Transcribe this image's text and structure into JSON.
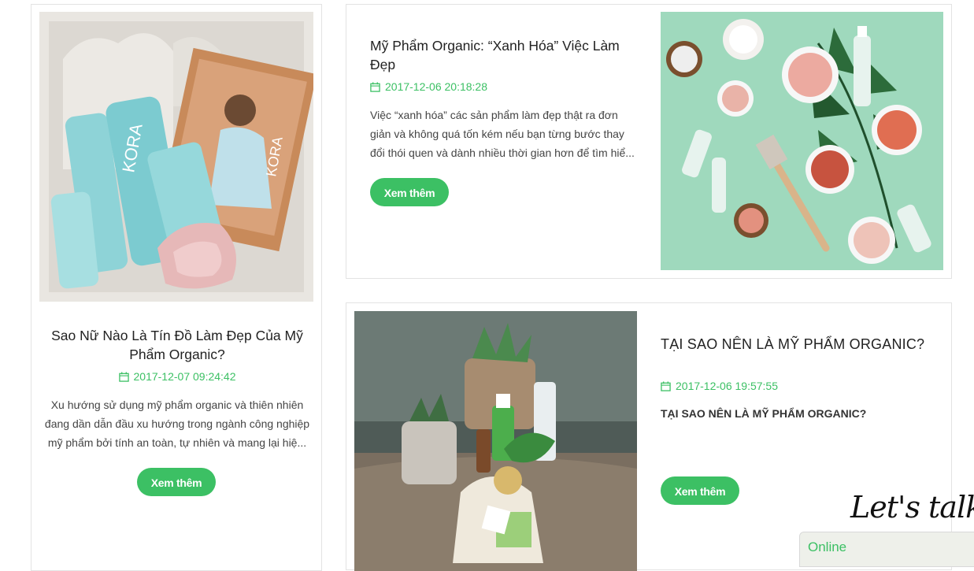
{
  "posts": [
    {
      "title_line1": "Sao Nữ Nào Là Tín Đồ Làm Đẹp Của Mỹ",
      "title_line2": "Phẩm Organic?",
      "date": "2017-12-07 09:24:42",
      "excerpt_line1": "Xu hướng sử dụng mỹ phẩm organic và thiên nhiên",
      "excerpt_line2": "đang dần dẫn đầu xu hướng trong ngành công nghiệp",
      "excerpt_line3": "mỹ phẩm bởi tính an toàn, tự nhiên và mang lại hiệ...",
      "button": "Xem thêm",
      "image_label": "KORA"
    },
    {
      "title_line1": "Mỹ Phẩm Organic: “Xanh Hóa” Việc Làm",
      "title_line2": "Đẹp",
      "date": "2017-12-06 20:18:28",
      "excerpt_line1": "Việc “xanh hóa” các sản phẩm làm đẹp thật ra đơn",
      "excerpt_line2": "giản và không quá tốn kém nếu bạn từng bước thay",
      "excerpt_line3": "đổi thói quen và dành nhiều thời gian hơn để tìm hiể...",
      "button": "Xem thêm"
    },
    {
      "title": "TẠI SAO NÊN LÀ MỸ PHẨM ORGANIC?",
      "date": "2017-12-06 19:57:55",
      "excerpt": "TẠI SAO NÊN LÀ MỸ PHẨM ORGANIC?",
      "button": "Xem thêm"
    }
  ],
  "chat": {
    "tagline": "Let's talk...",
    "status": "Online"
  },
  "colors": {
    "accent": "#3cc064",
    "border": "#e3e3e3",
    "mint": "#9fd9bd"
  },
  "icons": {
    "date": "calendar-icon"
  }
}
